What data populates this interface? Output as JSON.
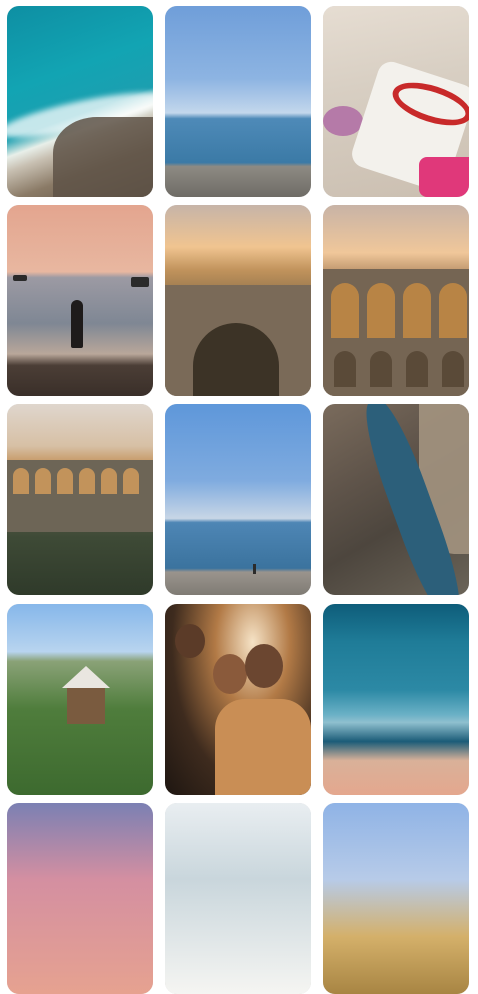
{
  "gallery": {
    "photos": [
      {
        "icon": "aerial-sea-rocks-image"
      },
      {
        "icon": "sea-horizon-pebble-beach-image"
      },
      {
        "icon": "beach-bag-on-sand-image"
      },
      {
        "icon": "silhouette-sunset-shore-image"
      },
      {
        "icon": "aqueduct-arch-image"
      },
      {
        "icon": "aqueduct-arcade-image"
      },
      {
        "icon": "aqueduct-over-forest-image"
      },
      {
        "icon": "sea-horizon-figure-image"
      },
      {
        "icon": "canyon-river-image"
      },
      {
        "icon": "forest-cabin-image"
      },
      {
        "icon": "friends-selfie-night-image"
      },
      {
        "icon": "abstract-blurred-sea-image"
      },
      {
        "icon": "sunset-sky-image"
      },
      {
        "icon": "surf-water-image"
      },
      {
        "icon": "coastal-town-cliffs-image"
      }
    ]
  }
}
